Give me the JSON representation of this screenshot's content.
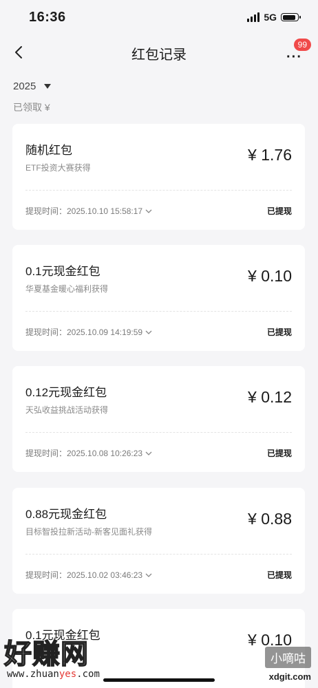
{
  "status_bar": {
    "time": "16:36",
    "network": "5G"
  },
  "nav": {
    "title": "红包记录",
    "badge": "99"
  },
  "filter": {
    "year": "2025",
    "received_label": "已领取 ¥"
  },
  "records": [
    {
      "name": "随机红包",
      "source": "ETF投资大赛获得",
      "amount": "¥ 1.76",
      "time": "提现时间：2025.10.10 15:58:17",
      "status": "已提现"
    },
    {
      "name": "0.1元现金红包",
      "source": "华夏基金暖心福利获得",
      "amount": "¥ 0.10",
      "time": "提现时间：2025.10.09 14:19:59",
      "status": "已提现"
    },
    {
      "name": "0.12元现金红包",
      "source": "天弘收益挑战活动获得",
      "amount": "¥ 0.12",
      "time": "提现时间：2025.10.08 10:26:23",
      "status": "已提现"
    },
    {
      "name": "0.88元现金红包",
      "source": "目标智投拉新活动-新客见面礼获得",
      "amount": "¥ 0.88",
      "time": "提现时间：2025.10.02 03:46:23",
      "status": "已提现"
    },
    {
      "name": "0.1元现金红包",
      "source": "",
      "amount": "¥ 0.10",
      "time": "",
      "status": ""
    }
  ],
  "watermark": {
    "left_text": "好赚网",
    "url_prefix": "www.zhuan",
    "url_highlight": "yes",
    "url_suffix": ".com",
    "right_text": "小嘀咕",
    "right_site": "xdgit.com"
  }
}
